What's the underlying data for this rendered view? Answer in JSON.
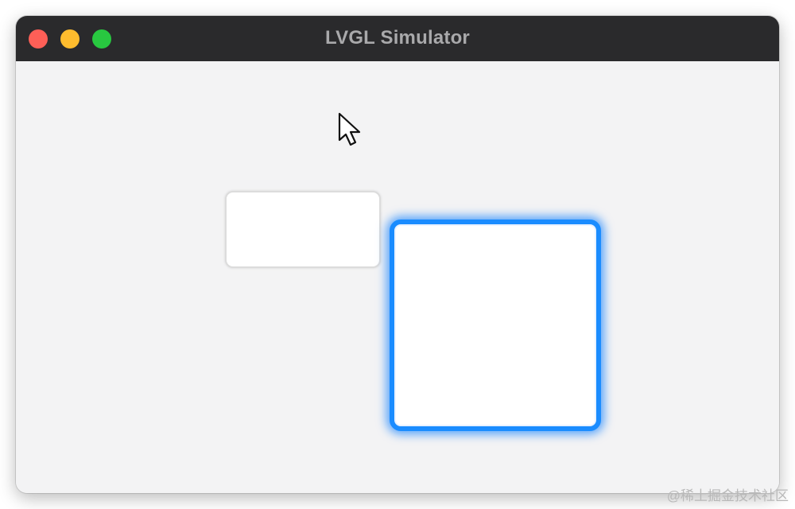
{
  "window": {
    "title": "LVGL Simulator"
  },
  "icons": {
    "close": "close-icon",
    "minimize": "minimize-icon",
    "zoom": "zoom-icon",
    "cursor": "mouse-pointer-icon"
  },
  "colors": {
    "titlebar": "#2a2a2c",
    "content_background": "#f3f3f4",
    "focus_outline": "#1a8cff",
    "close": "#fe5f57",
    "minimize": "#febc2e",
    "zoom": "#28c840"
  },
  "watermark": "@稀土掘金技术社区"
}
